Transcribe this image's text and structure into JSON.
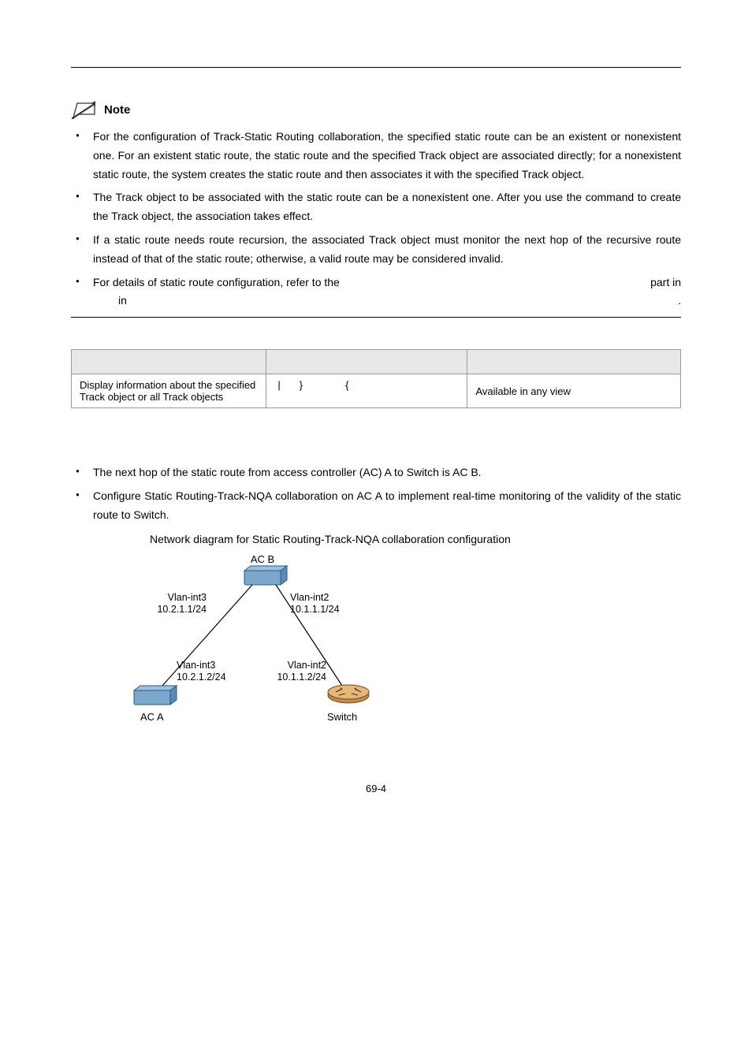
{
  "note": {
    "label": "Note",
    "items": [
      "For the configuration of Track-Static Routing collaboration, the specified static route can be an existent or nonexistent one. For an existent static route, the static route and the specified Track object are associated directly; for a nonexistent static route, the system creates the static route and then associates it with the specified Track object.",
      "The Track object to be associated with the static route can be a nonexistent one. After you use the command to create the Track object, the association takes effect.",
      "If a static route needs route recursion, the associated Track object must monitor the next hop of the recursive route instead of that of the static route; otherwise, a valid route may be considered invalid."
    ],
    "item4_part1": "For details of static route configuration, refer to the",
    "item4_part2": "part in",
    "item4_part3": "in",
    "item4_part4": "."
  },
  "table": {
    "row": {
      "desc": "Display information about the specified Track object or all Track objects",
      "pipe": "|",
      "lbrace": "{",
      "rbrace": "}",
      "remarks": "Available in any view"
    }
  },
  "example": {
    "bullets": [
      "The next hop of the static route from access controller (AC) A to Switch is AC B.",
      "Configure Static Routing-Track-NQA collaboration on AC A to implement real-time monitoring of the validity of the static route to Switch."
    ],
    "fig_caption": "Network diagram for Static Routing-Track-NQA collaboration configuration"
  },
  "diagram": {
    "acb": "AC B",
    "vlan3_top": "Vlan-int3",
    "vlan3_top_ip": "10.2.1.1/24",
    "vlan2_top": "Vlan-int2",
    "vlan2_top_ip": "10.1.1.1/24",
    "vlan3_bot": "Vlan-int3",
    "vlan3_bot_ip": "10.2.1.2/24",
    "vlan2_bot": "Vlan-int2",
    "vlan2_bot_ip": "10.1.1.2/24",
    "aca": "AC A",
    "switch": "Switch"
  },
  "page_num": "69-4"
}
